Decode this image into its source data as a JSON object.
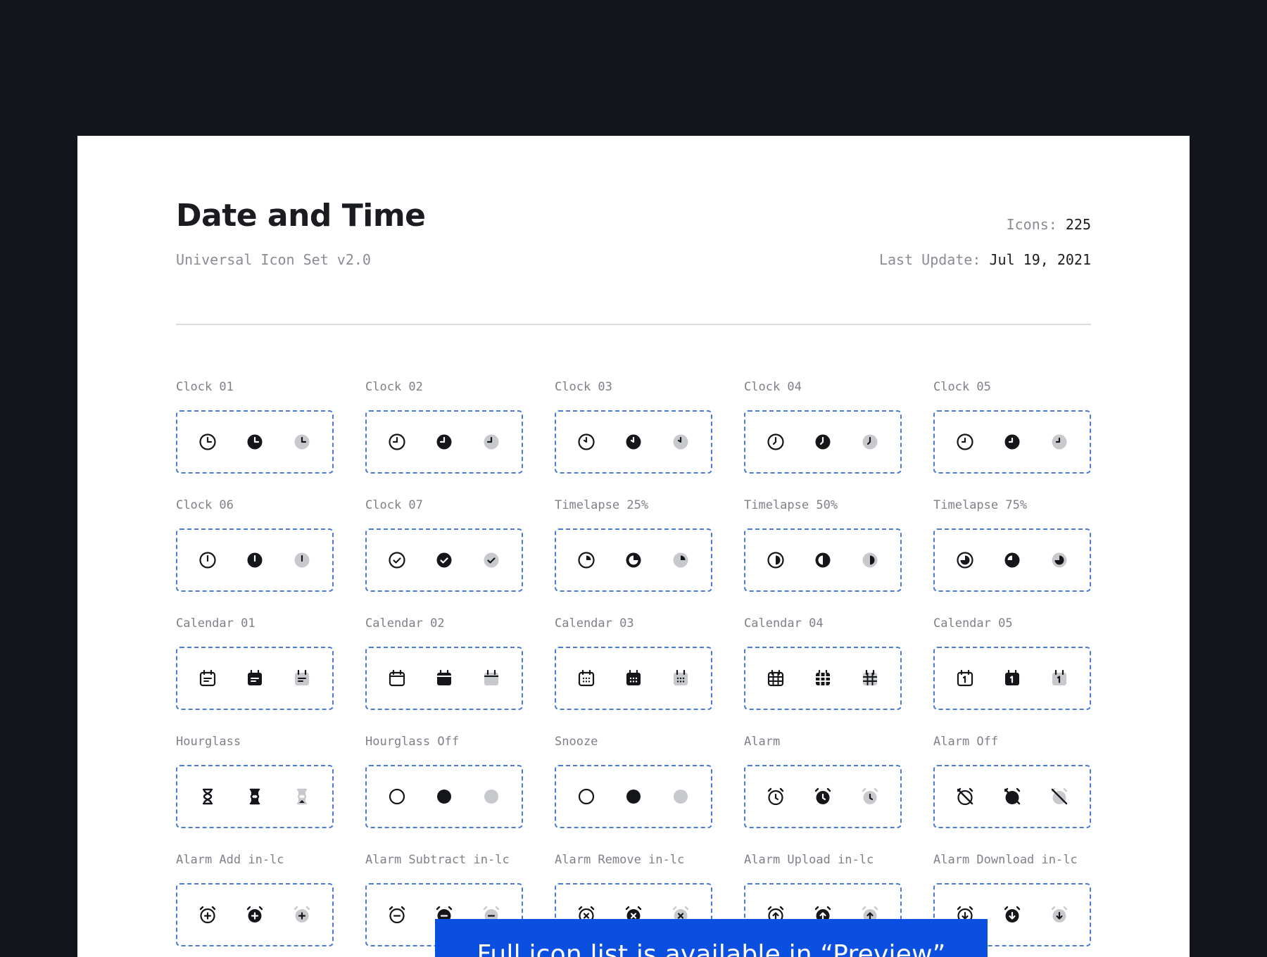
{
  "header": {
    "title": "Date and Time",
    "subtitle": "Universal Icon Set v2.0",
    "icons_label": "Icons:",
    "icons_count": "225",
    "update_label": "Last Update:",
    "update_date": "Jul 19, 2021"
  },
  "banner": {
    "text": "Full icon list is available in “Preview”"
  },
  "styles": [
    "outline",
    "solid",
    "duotone"
  ],
  "colors": {
    "accent_border": "#4c7ad9",
    "banner_bg": "#0b4fe0",
    "icon_dark": "#15161a",
    "icon_grey": "#c8c9cc"
  },
  "icons": [
    {
      "label": "Clock 01",
      "icon": "clock-icon"
    },
    {
      "label": "Clock 02",
      "icon": "clock-icon"
    },
    {
      "label": "Clock 03",
      "icon": "clock-icon"
    },
    {
      "label": "Clock 04",
      "icon": "clock-icon"
    },
    {
      "label": "Clock 05",
      "icon": "clock-icon"
    },
    {
      "label": "Clock 06",
      "icon": "clock-icon"
    },
    {
      "label": "Clock 07",
      "icon": "clock-check-icon"
    },
    {
      "label": "Timelapse 25%",
      "icon": "timelapse-icon"
    },
    {
      "label": "Timelapse 50%",
      "icon": "timelapse-icon"
    },
    {
      "label": "Timelapse 75%",
      "icon": "timelapse-icon"
    },
    {
      "label": "Calendar 01",
      "icon": "calendar-icon"
    },
    {
      "label": "Calendar 02",
      "icon": "calendar-icon"
    },
    {
      "label": "Calendar 03",
      "icon": "calendar-icon"
    },
    {
      "label": "Calendar 04",
      "icon": "calendar-grid-icon"
    },
    {
      "label": "Calendar 05",
      "icon": "calendar-date-icon"
    },
    {
      "label": "Hourglass",
      "icon": "hourglass-icon"
    },
    {
      "label": "Hourglass Off",
      "icon": "hourglass-off-icon"
    },
    {
      "label": "Snooze",
      "icon": "snooze-icon"
    },
    {
      "label": "Alarm",
      "icon": "alarm-icon"
    },
    {
      "label": "Alarm Off",
      "icon": "alarm-off-icon"
    },
    {
      "label": "Alarm Add in-lc",
      "icon": "alarm-add-icon"
    },
    {
      "label": "Alarm Subtract in-lc",
      "icon": "alarm-subtract-icon"
    },
    {
      "label": "Alarm Remove in-lc",
      "icon": "alarm-remove-icon"
    },
    {
      "label": "Alarm Upload in-lc",
      "icon": "alarm-upload-icon"
    },
    {
      "label": "Alarm Download in-lc",
      "icon": "alarm-download-icon"
    }
  ]
}
